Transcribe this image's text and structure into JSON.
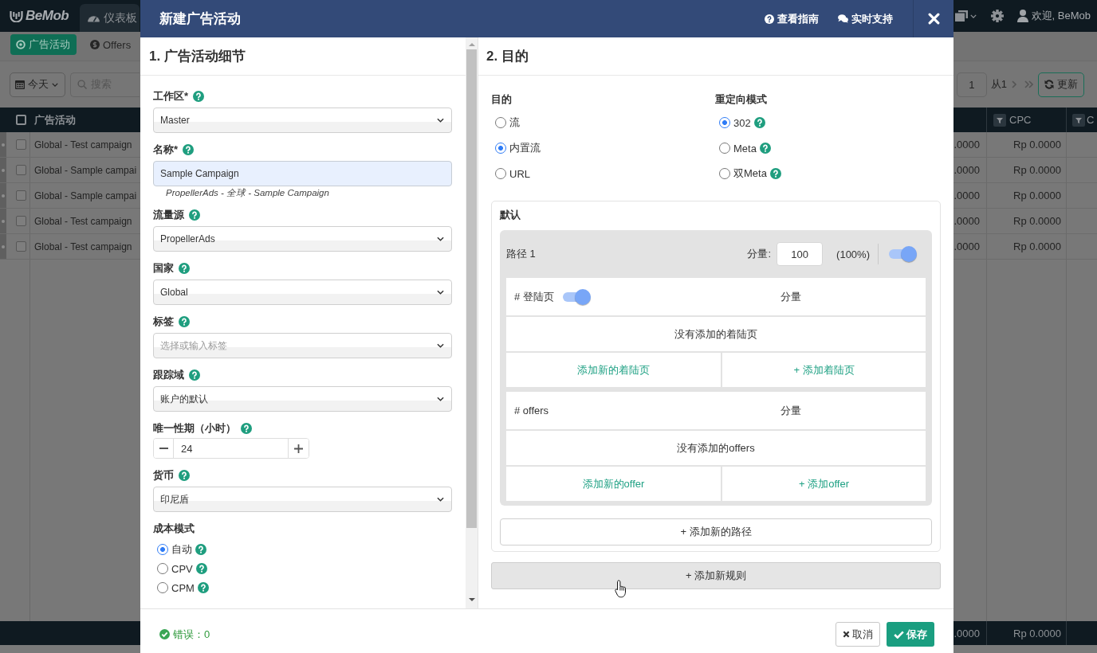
{
  "app": {
    "navbar": {
      "logo": "BeMob",
      "tabs": [
        {
          "label": "仪表板",
          "selected": true
        }
      ],
      "user": "欢迎, BeMob"
    },
    "subnav": [
      {
        "label": "广告活动",
        "selected": true
      },
      {
        "label": "Offers",
        "selected": false
      }
    ],
    "toolbar": {
      "date_button": "今天",
      "search": {
        "placeholder": "搜索"
      },
      "page": "1",
      "page_count": "从1",
      "refresh_button": "更新"
    },
    "table": {
      "select_all": {
        "checked": false
      },
      "columns": [
        {
          "label": "广告活动",
          "filter": false
        },
        {
          "label": "CPC",
          "filter": true
        },
        {
          "label": "C",
          "filter": true
        }
      ],
      "rows": [
        {
          "checked": false,
          "name": "Global - Test campaign",
          "cells": [
            ".0000",
            "Rp 0.0000"
          ]
        },
        {
          "checked": false,
          "name": "Global - Sample campai",
          "cells": [
            ".0000",
            "Rp 0.0000"
          ]
        },
        {
          "checked": false,
          "name": "Global - Sample campai",
          "cells": [
            ".0000",
            "Rp 0.0000"
          ]
        },
        {
          "checked": false,
          "name": "Global - Test campaign",
          "cells": [
            ".0000",
            "Rp 0.0000"
          ]
        },
        {
          "checked": false,
          "name": "Global - Test campaign",
          "cells": [
            ".0000",
            "Rp 0.0000"
          ]
        }
      ],
      "totals": [
        ".0000",
        "Rp 0.0000"
      ]
    }
  },
  "modal": {
    "title": "新建广告活动",
    "links": [
      {
        "kind": "guide",
        "label": "查看指南"
      },
      {
        "kind": "chat",
        "label": "实时支持"
      }
    ],
    "details": {
      "heading": "1. 广告活动细节",
      "fields": [
        {
          "kind": "select",
          "label": "工作区*",
          "help": true,
          "value": "Master"
        },
        {
          "kind": "text",
          "label": "名称*",
          "help": true,
          "value": "Sample Campaign",
          "hint": "PropellerAds - 全球 - Sample Campaign"
        },
        {
          "kind": "select",
          "label": "流量源",
          "help": true,
          "value": "PropellerAds"
        },
        {
          "kind": "select",
          "label": "国家",
          "help": true,
          "value": "Global"
        },
        {
          "kind": "select",
          "label": "标签",
          "help": true,
          "placeholder": "选择或输入标签"
        },
        {
          "kind": "select",
          "label": "跟踪域",
          "help": true,
          "value": "账户的默认"
        },
        {
          "kind": "stepper",
          "label": "唯一性期（小时）",
          "help": true,
          "value": "24"
        },
        {
          "kind": "select",
          "label": "货币",
          "help": true,
          "value": "印尼盾"
        },
        {
          "kind": "radios",
          "label": "成本模式",
          "options": [
            {
              "label": "自动",
              "selected": true,
              "help": true
            },
            {
              "label": "CPV",
              "selected": false,
              "help": true
            },
            {
              "label": "CPM",
              "selected": false,
              "help": true
            }
          ]
        }
      ]
    },
    "goal": {
      "heading": "2. 目的",
      "groups": [
        {
          "label": "目的",
          "options": [
            {
              "label": "流",
              "selected": false
            },
            {
              "label": "内置流",
              "selected": true
            },
            {
              "label": "URL",
              "selected": false
            }
          ]
        },
        {
          "label": "重定向模式",
          "options": [
            {
              "label": "302",
              "selected": true,
              "help": true
            },
            {
              "label": "Meta",
              "selected": false,
              "help": true
            },
            {
              "label": "双Meta",
              "selected": false,
              "help": true
            }
          ]
        }
      ],
      "rule": {
        "title": "默认",
        "paths": [
          {
            "name": "路径 1",
            "weight_label": "分量:",
            "weight": "100",
            "share": "(100%)",
            "on": true,
            "sections": [
              {
                "title": "# 登陆页",
                "on": true,
                "weight_label": "分量",
                "empty": "没有添加的着陆页",
                "actions": [
                  "添加新的着陆页",
                  "+ 添加着陆页"
                ]
              },
              {
                "title": "# offers",
                "weight_label": "分量",
                "empty": "没有添加的offers",
                "actions": [
                  "添加新的offer",
                  "+ 添加offer"
                ]
              }
            ]
          }
        ],
        "add_path_button": "+ 添加新的路径"
      },
      "add_rule_button": "+ 添加新规则"
    },
    "footer": {
      "status": "错误：0",
      "buttons": [
        {
          "kind": "cancel",
          "label": "取消"
        },
        {
          "kind": "save",
          "label": "保存"
        }
      ]
    }
  }
}
